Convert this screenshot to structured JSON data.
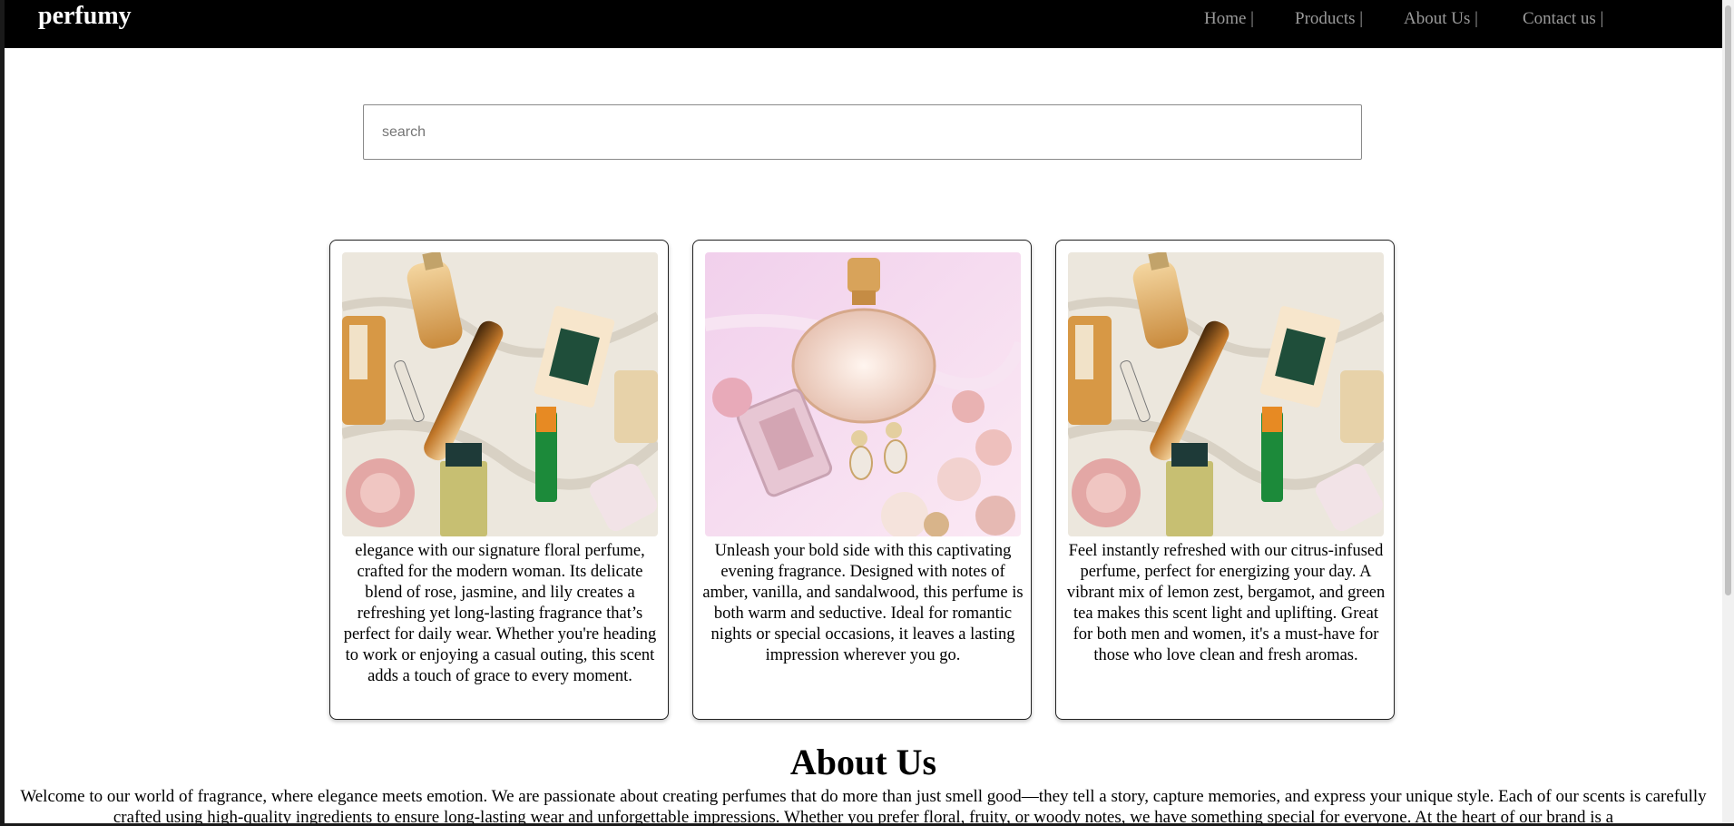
{
  "brand": {
    "name": "perfumy"
  },
  "nav": {
    "items": [
      {
        "label": "Home |"
      },
      {
        "label": "Products |"
      },
      {
        "label": "About Us |"
      },
      {
        "label": "Contact us |"
      }
    ]
  },
  "search": {
    "placeholder": "search",
    "value": ""
  },
  "products": [
    {
      "image": "perfume-bottles-flatlay",
      "description": "elegance with our signature floral perfume, crafted for the modern woman. Its delicate blend of rose, jasmine, and lily creates a refreshing yet long-lasting fragrance that’s perfect for daily wear. Whether you're heading to work or enjoying a casual outing, this scent adds a touch of grace to every moment."
    },
    {
      "image": "pink-perfume-with-earrings",
      "description": "Unleash your bold side with this captivating evening fragrance. Designed with notes of amber, vanilla, and sandalwood, this perfume is both warm and seductive. Ideal for romantic nights or special occasions, it leaves a lasting impression wherever you go."
    },
    {
      "image": "perfume-bottles-flatlay",
      "description": "Feel instantly refreshed with our citrus-infused perfume, perfect for energizing your day. A vibrant mix of lemon zest, bergamot, and green tea makes this scent light and uplifting. Great for both men and women, it's a must-have for those who love clean and fresh aromas."
    }
  ],
  "about": {
    "title": "About Us",
    "text": "Welcome to our world of fragrance, where elegance meets emotion. We are passionate about creating perfumes that do more than just smell good—they tell a story, capture memories, and express your unique style. Each of our scents is carefully crafted using high-quality ingredients to ensure long-lasting wear and unforgettable impressions. Whether you prefer floral, fruity, or woody notes, we have something special for everyone. At the heart of our brand is a"
  },
  "colors": {
    "navbar_bg": "#000000",
    "nav_link": "#9a9a9a",
    "logo": "#ffffff",
    "card_border": "#222222"
  }
}
